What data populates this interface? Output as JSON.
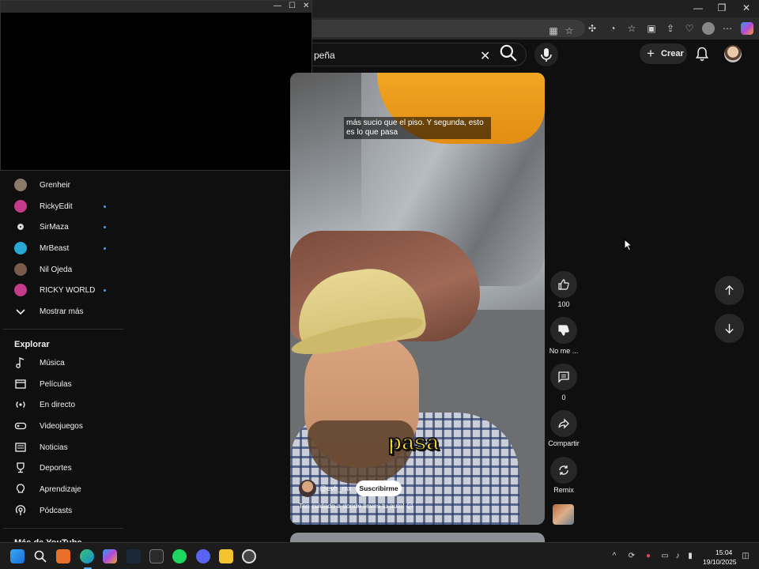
{
  "search": {
    "query": "peña"
  },
  "header": {
    "create_label": "Crear"
  },
  "subscriptions": [
    {
      "name": "Grenheir",
      "new": false,
      "color": "#8a7a6a"
    },
    {
      "name": "RickyEdit",
      "new": true,
      "color": "#c43b8c"
    },
    {
      "name": "SirMaza",
      "new": true,
      "color": "#ffffff"
    },
    {
      "name": "MrBeast",
      "new": true,
      "color": "#29a8d6"
    },
    {
      "name": "Nil Ojeda",
      "new": false,
      "color": "#7a5a4a"
    },
    {
      "name": "RICKY WORLD",
      "new": true,
      "color": "#c43b8c"
    }
  ],
  "sidebar": {
    "show_more": "Mostrar más",
    "explore_heading": "Explorar",
    "explore_items": [
      "Música",
      "Películas",
      "En directo",
      "Videojuegos",
      "Noticias",
      "Deportes",
      "Aprendizaje",
      "Pódcasts"
    ],
    "more_heading": "Más de YouTube"
  },
  "short": {
    "caption_top": "más sucio que el piso. Y segunda, esto es lo que pasa",
    "caption_big": "pasa",
    "author": "@evh_mx",
    "subscribe_label": "Suscribirme",
    "description": "Ten cuidado a donde lleves tu auto! 😕"
  },
  "actions": {
    "like_count": "100",
    "dislike_label": "No me ...",
    "comment_count": "0",
    "share_label": "Compartir",
    "remix_label": "Remix"
  },
  "taskbar": {
    "time": "15:04",
    "date": "19/10/2025"
  },
  "colors": {
    "background": "#0f0f0f",
    "accent_dot": "#3ea6ff",
    "caption_yellow": "#ffe234"
  }
}
